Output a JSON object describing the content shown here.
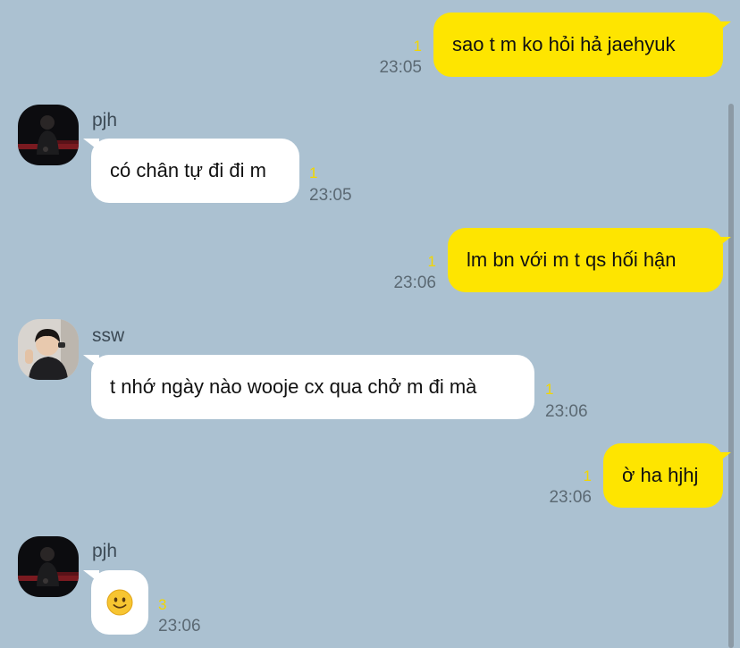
{
  "messages": [
    {
      "direction": "out",
      "text": "sao t m ko hỏi hả jaehyuk",
      "unread": "1",
      "time": "23:05"
    },
    {
      "direction": "in",
      "sender": "pjh",
      "avatar": "person-dark-photo-icon",
      "text": "có chân tự đi đi m",
      "unread": "1",
      "time": "23:05"
    },
    {
      "direction": "out",
      "text": "lm bn với m t qs hối hận",
      "unread": "1",
      "time": "23:06"
    },
    {
      "direction": "in",
      "sender": "ssw",
      "avatar": "person-light-photo-icon",
      "text": "t nhớ ngày nào wooje cx qua chở m đi mà",
      "unread": "1",
      "time": "23:06"
    },
    {
      "direction": "out",
      "text": "ờ ha hjhj",
      "unread": "1",
      "time": "23:06"
    },
    {
      "direction": "in",
      "sender": "pjh",
      "avatar": "person-dark-photo-icon",
      "emoji": "slightly-smiling-face-emoji",
      "unread": "3",
      "time": "23:06"
    }
  ],
  "colors": {
    "background": "#abc1d1",
    "outgoing_bubble": "#fee500",
    "incoming_bubble": "#ffffff",
    "unread_count": "#f2d600",
    "timestamp": "#5b6973"
  }
}
